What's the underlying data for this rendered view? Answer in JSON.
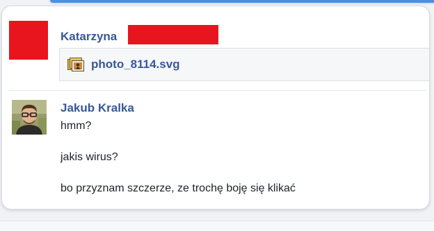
{
  "thread": {
    "first_message": {
      "sender_name": "Katarzyna",
      "attachment": {
        "icon": "image-file-icon",
        "file_name": "photo_8114.svg"
      }
    },
    "second_message": {
      "sender_name": "Jakub Kralka",
      "lines": [
        "hmm?",
        "jakis wirus?",
        "bo przyznam szczerze, ze trochę boję się klikać"
      ]
    }
  },
  "colors": {
    "link_blue": "#365899",
    "redaction_red": "#e8151e",
    "text": "#1d2129",
    "accent_blue": "#4a90e2"
  }
}
